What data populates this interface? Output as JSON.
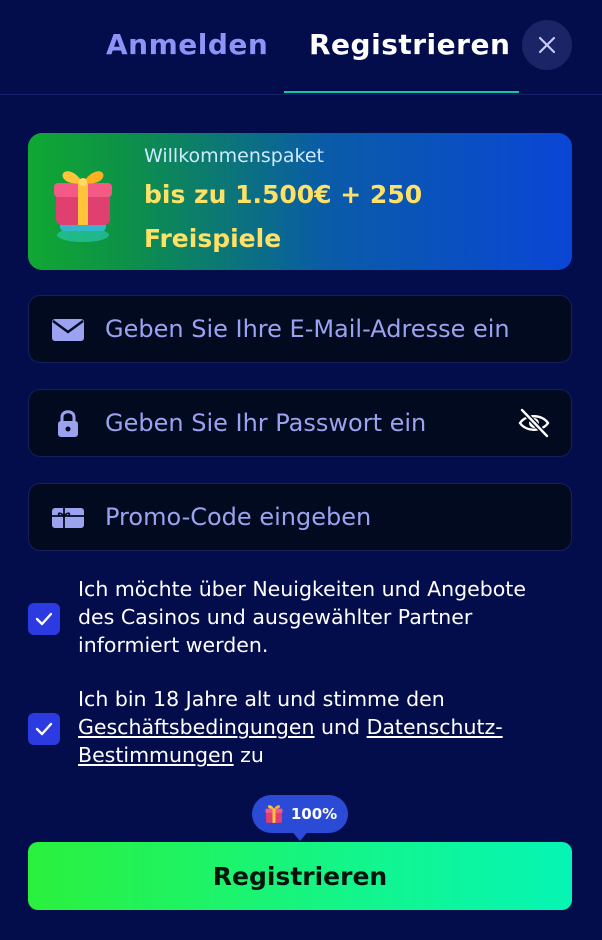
{
  "tabs": {
    "login": "Anmelden",
    "register": "Registrieren"
  },
  "banner": {
    "title": "Willkommenspaket",
    "offer": "bis zu 1.500€ + 250 Freispiele"
  },
  "fields": {
    "email_placeholder": "Geben Sie Ihre E-Mail-Adresse ein",
    "password_placeholder": "Geben Sie Ihr Passwort ein",
    "promo_placeholder": "Promo-Code eingeben"
  },
  "consents": {
    "news": {
      "checked": true,
      "text": "Ich möchte über Neuigkeiten und Angebote des Casinos und ausgewählter Partner informiert werden."
    },
    "terms": {
      "checked": true,
      "prefix": "Ich bin 18 Jahre alt und stimme den ",
      "terms_link": "Geschäftsbedingungen",
      "middle": " und ",
      "privacy_link": "Datenschutz-Bestimmungen",
      "suffix": " zu"
    }
  },
  "progress": {
    "label": "100%",
    "value": 100
  },
  "submit_label": "Registrieren",
  "colors": {
    "background": "#040d4c",
    "accent": "#2c3ae2",
    "offer": "#ffe168",
    "button_start": "#2bf13d",
    "button_end": "#05f5b4"
  },
  "icons": {
    "close": "close-icon",
    "gift": "gift-icon",
    "email": "envelope-icon",
    "password": "lock-icon",
    "visibility": "eye-off-icon",
    "promo": "gift-card-icon",
    "check": "check-icon"
  }
}
